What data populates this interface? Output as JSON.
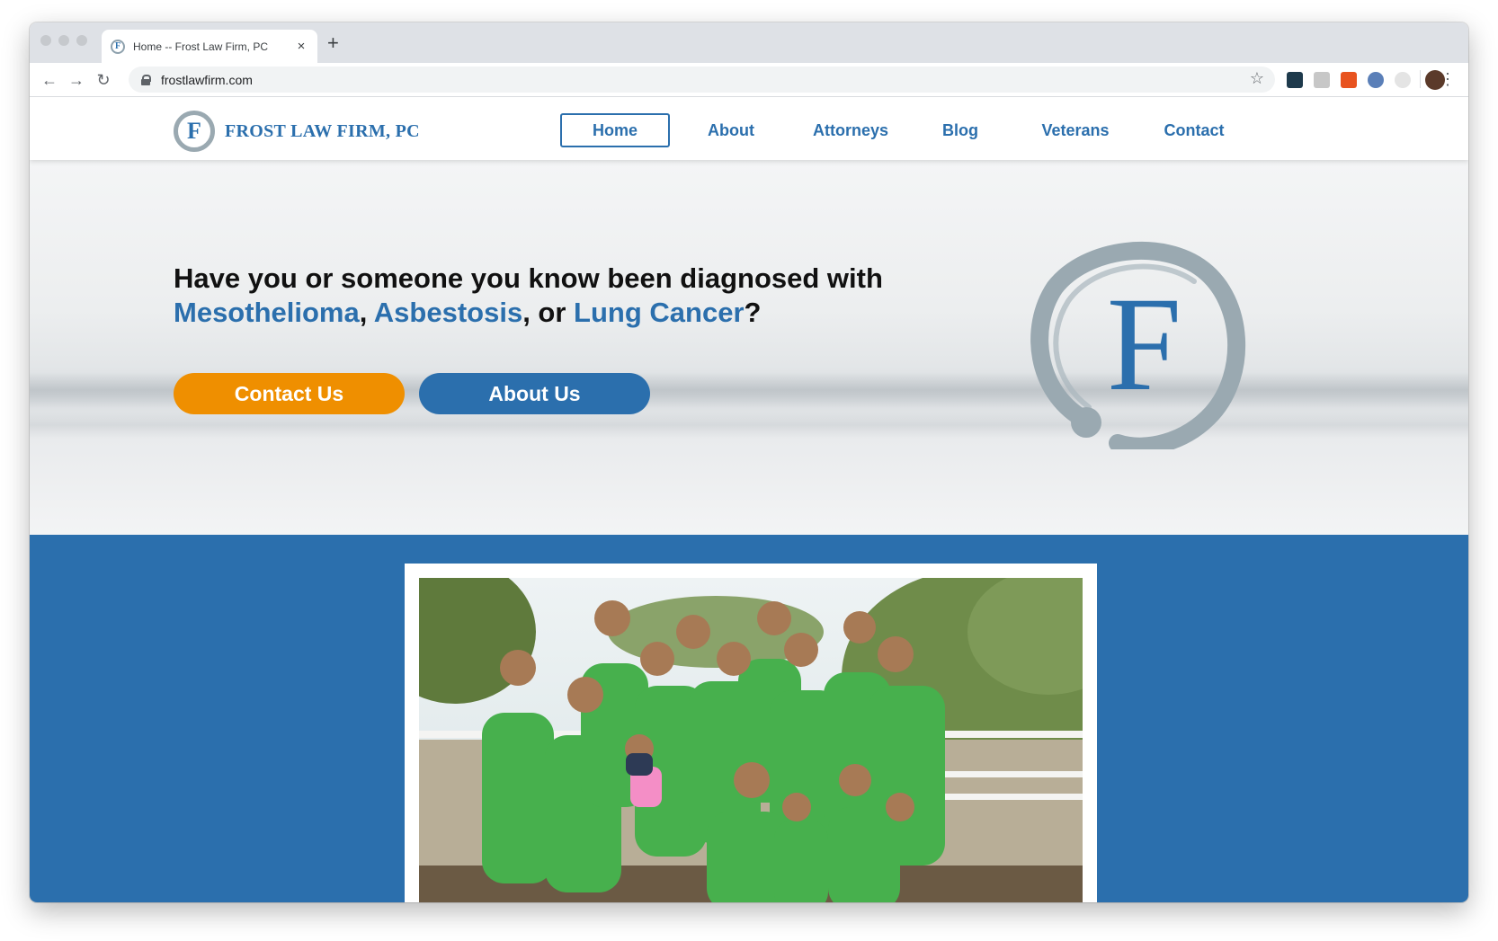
{
  "browser": {
    "tab": {
      "title": "Home -- Frost Law Firm, PC",
      "favicon": "frost-f-icon",
      "close": "×"
    },
    "new_tab": "+",
    "toolbar": {
      "back": "←",
      "forward": "→",
      "reload": "↻",
      "url": "frostlawfirm.com",
      "star": "☆",
      "menu": "⋮"
    }
  },
  "site": {
    "logo": {
      "mark": "F",
      "name": "FROST LAW FIRM, PC"
    },
    "nav": [
      {
        "label": "Home",
        "active": true
      },
      {
        "label": "About"
      },
      {
        "label": "Attorneys"
      },
      {
        "label": "Blog"
      },
      {
        "label": "Veterans"
      },
      {
        "label": "Contact"
      }
    ],
    "hero": {
      "line1": "Have you or someone you know been diagnosed with",
      "term1": "Mesothelioma",
      "sep1": ", ",
      "term2": "Asbestosis",
      "sep2": ", or ",
      "term3": "Lung Cancer",
      "end": "?",
      "contact_button": "Contact Us",
      "about_button": "About Us",
      "big_logo_letter": "F"
    },
    "colors": {
      "brand_blue": "#2b6fad",
      "brand_orange": "#ef8f00",
      "logo_grey": "#9aa9b1"
    }
  }
}
